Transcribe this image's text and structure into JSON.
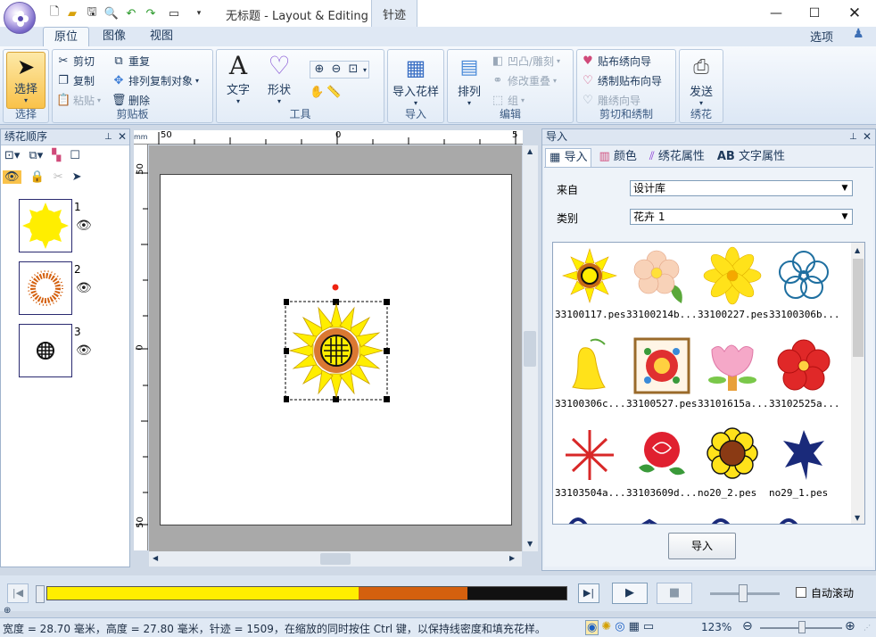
{
  "window": {
    "title": "无标题 - Layout & Editing",
    "context_tab": "针迹",
    "context_subtab": "针迹"
  },
  "tabs": [
    "原位",
    "图像",
    "视图"
  ],
  "options_label": "选项",
  "ribbon": {
    "select": {
      "label": "选择",
      "group": "选择"
    },
    "clipboard": {
      "cut": "剪切",
      "copy": "复制",
      "paste": "粘贴",
      "duplicate": "重复",
      "array_copy": "排列复制对象",
      "delete": "删除",
      "group": "剪贴板"
    },
    "tools": {
      "text": "文字",
      "shape": "形状",
      "group": "工具"
    },
    "import": {
      "label": "导入花样",
      "group": "导入"
    },
    "edit": {
      "arrange": "排列",
      "emboss": "凹凸/雕刻",
      "overlap": "修改重叠",
      "grp": "组",
      "group": "编辑"
    },
    "applique": {
      "wizard": "贴布绣向导",
      "make": "绣制贴布向导",
      "cutwork": "雕绣向导",
      "group": "剪切和绣制"
    },
    "send": {
      "label": "发送",
      "group": "绣花"
    }
  },
  "left_panel": {
    "title": "绣花顺序",
    "items": [
      {
        "num": "1"
      },
      {
        "num": "2"
      },
      {
        "num": "3"
      }
    ]
  },
  "ruler": {
    "unit": "mm",
    "h_ticks": [
      "50",
      "0",
      "5"
    ],
    "v_ticks": [
      "50",
      "0",
      "50"
    ]
  },
  "right_panel": {
    "title": "导入",
    "tabs": [
      "导入",
      "颜色",
      "绣花属性",
      "文字属性"
    ],
    "from_label": "来自",
    "from_value": "设计库",
    "category_label": "类别",
    "category_value": "花卉 1",
    "items": [
      "33100117.pes",
      "33100214b...",
      "33100227.pes",
      "33100306b...",
      "33100306c...",
      "33100527.pes",
      "33101615a...",
      "33102525a...",
      "33103504a...",
      "33103609d...",
      "no20_2.pes",
      "no29_1.pes"
    ],
    "import_button": "导入"
  },
  "stitch": {
    "auto_scroll": "自动滚动",
    "progress_colors": [
      "#ffee00",
      "#d4600e",
      "#111111"
    ],
    "progress_split": [
      0.6,
      0.21,
      0.19
    ]
  },
  "status": {
    "text": "宽度 = 28.70 毫米，高度 = 27.80 毫米，针迹 = 1509，在缩放的同时按住 Ctrl 键，以保持线密度和填充花样。",
    "zoom": "123%"
  }
}
